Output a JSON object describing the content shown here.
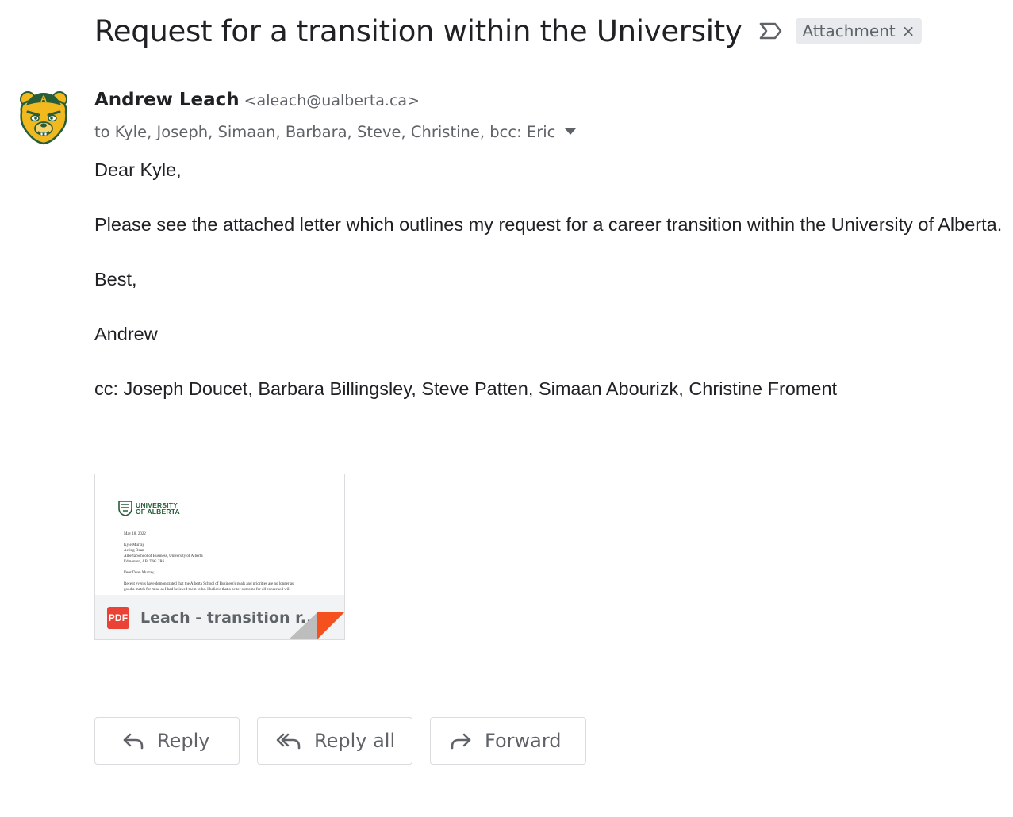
{
  "email": {
    "subject": "Request for a transition within the University",
    "label_chip": {
      "text": "Attachment",
      "close": "×"
    },
    "sender": {
      "name": "Andrew Leach",
      "email": "<aleach@ualberta.ca>",
      "avatar_letter": "A"
    },
    "recipients": "to Kyle, Joseph, Simaan, Barbara, Steve, Christine, bcc: Eric",
    "body": {
      "greeting": "Dear Kyle,",
      "paragraph": "Please see the attached letter which outlines my request for a career transition within the University of Alberta.",
      "closing": "Best,",
      "signature": "Andrew",
      "cc_line": "cc: Joseph Doucet, Barbara Billingsley, Steve Patten, Simaan Abourizk, Christine Froment"
    }
  },
  "attachment": {
    "filename": "Leach - transition r...",
    "type_badge": "PDF",
    "preview": {
      "logo_line1": "UNIVERSITY",
      "logo_line2": "OF ALBERTA",
      "lines": [
        "May 18, 2022",
        "Kyle Murray",
        "Acting Dean",
        "Alberta School of Business, University of Alberta",
        "Edmonton, AB, T6G 2R6",
        "Dear Dean Murray,",
        "Recent events have demonstrated that the Alberta School of Business's goals and priorities are no longer as",
        "good a match for mine as I had believed them to be. I believe that a better outcome for all concerned will"
      ]
    }
  },
  "actions": {
    "reply": "Reply",
    "reply_all": "Reply all",
    "forward": "Forward"
  },
  "colors": {
    "text_primary": "#202124",
    "text_secondary": "#5f6368",
    "pdf_red": "#ea4335",
    "uofa_green": "#275d38",
    "uofa_gold": "#f2b91e"
  }
}
